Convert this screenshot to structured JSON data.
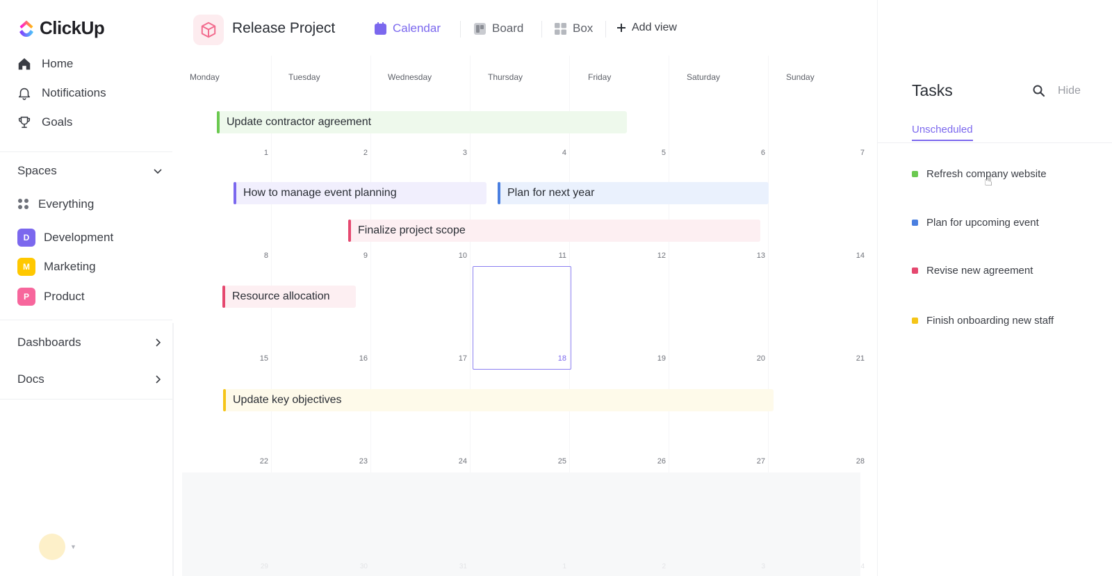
{
  "app": {
    "name": "ClickUp"
  },
  "sidebar": {
    "nav": [
      {
        "label": "Home",
        "icon": "home-icon"
      },
      {
        "label": "Notifications",
        "icon": "bell-icon"
      },
      {
        "label": "Goals",
        "icon": "trophy-icon"
      }
    ],
    "spaces_label": "Spaces",
    "everything_label": "Everything",
    "spaces": [
      {
        "label": "Development",
        "initial": "D",
        "color": "#7b68ee"
      },
      {
        "label": "Marketing",
        "initial": "M",
        "color": "#ffc800"
      },
      {
        "label": "Product",
        "initial": "P",
        "color": "#f7669c"
      }
    ],
    "dashboards_label": "Dashboards",
    "docs_label": "Docs"
  },
  "header": {
    "project_title": "Release Project",
    "views": [
      {
        "label": "Calendar",
        "active": true
      },
      {
        "label": "Board"
      },
      {
        "label": "Box"
      }
    ],
    "add_view_label": "Add view"
  },
  "calendar": {
    "days": [
      "Monday",
      "Tuesday",
      "Wednesday",
      "Thursday",
      "Friday",
      "Saturday",
      "Sunday"
    ],
    "weeks": [
      [
        "1",
        "2",
        "3",
        "4",
        "5",
        "6",
        "7"
      ],
      [
        "8",
        "9",
        "10",
        "11",
        "12",
        "13",
        "14"
      ],
      [
        "15",
        "16",
        "17",
        "18",
        "19",
        "20",
        "21"
      ],
      [
        "22",
        "23",
        "24",
        "25",
        "26",
        "27",
        "28"
      ],
      [
        "29",
        "30",
        "31",
        "1",
        "2",
        "3",
        "4"
      ]
    ],
    "today": "18",
    "events": [
      {
        "title": "Update contractor agreement",
        "color": "#6bc950"
      },
      {
        "title": "How to manage event planning",
        "color": "#7b68ee"
      },
      {
        "title": "Plan for next year",
        "color": "#4a7fe0"
      },
      {
        "title": "Finalize project scope",
        "color": "#e5486f"
      },
      {
        "title": "Resource allocation",
        "color": "#e5486f"
      },
      {
        "title": "Update key objectives",
        "color": "#f5c518"
      }
    ]
  },
  "tasks_panel": {
    "title": "Tasks",
    "hide_label": "Hide",
    "tab_label": "Unscheduled",
    "tasks": [
      {
        "label": "Refresh company website",
        "color": "#6bc950"
      },
      {
        "label": "Plan for upcoming event",
        "color": "#4a7fe0"
      },
      {
        "label": "Revise new agreement",
        "color": "#e5486f"
      },
      {
        "label": "Finish onboarding new staff",
        "color": "#f5c518"
      }
    ]
  }
}
